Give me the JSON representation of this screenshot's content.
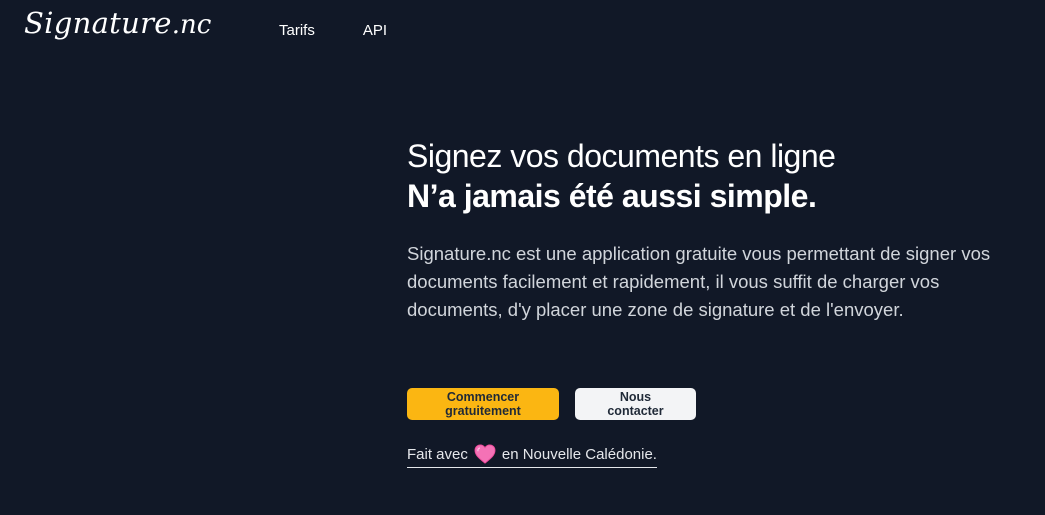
{
  "header": {
    "logo_main": "Signature",
    "logo_tld": ".nc",
    "nav": [
      {
        "label": "Tarifs"
      },
      {
        "label": "API"
      }
    ]
  },
  "hero": {
    "headline_line1": "Signez vos documents en ligne",
    "headline_line2": "N’a jamais été aussi simple.",
    "description": "Signature.nc est une application gratuite vous permettant de signer vos documents facilement et rapidement, il vous suffit de charger vos documents, d'y placer une zone de signature et de l'envoyer.",
    "primary_button": "Commencer gratuitement",
    "secondary_button": "Nous contacter",
    "made_with_prefix": "Fait avec",
    "made_with_suffix": "en Nouvelle Calédonie."
  },
  "colors": {
    "background": "#111827",
    "accent": "#fbb612",
    "heart": "#f472b6"
  },
  "icons": {
    "heart": "heart-icon"
  }
}
